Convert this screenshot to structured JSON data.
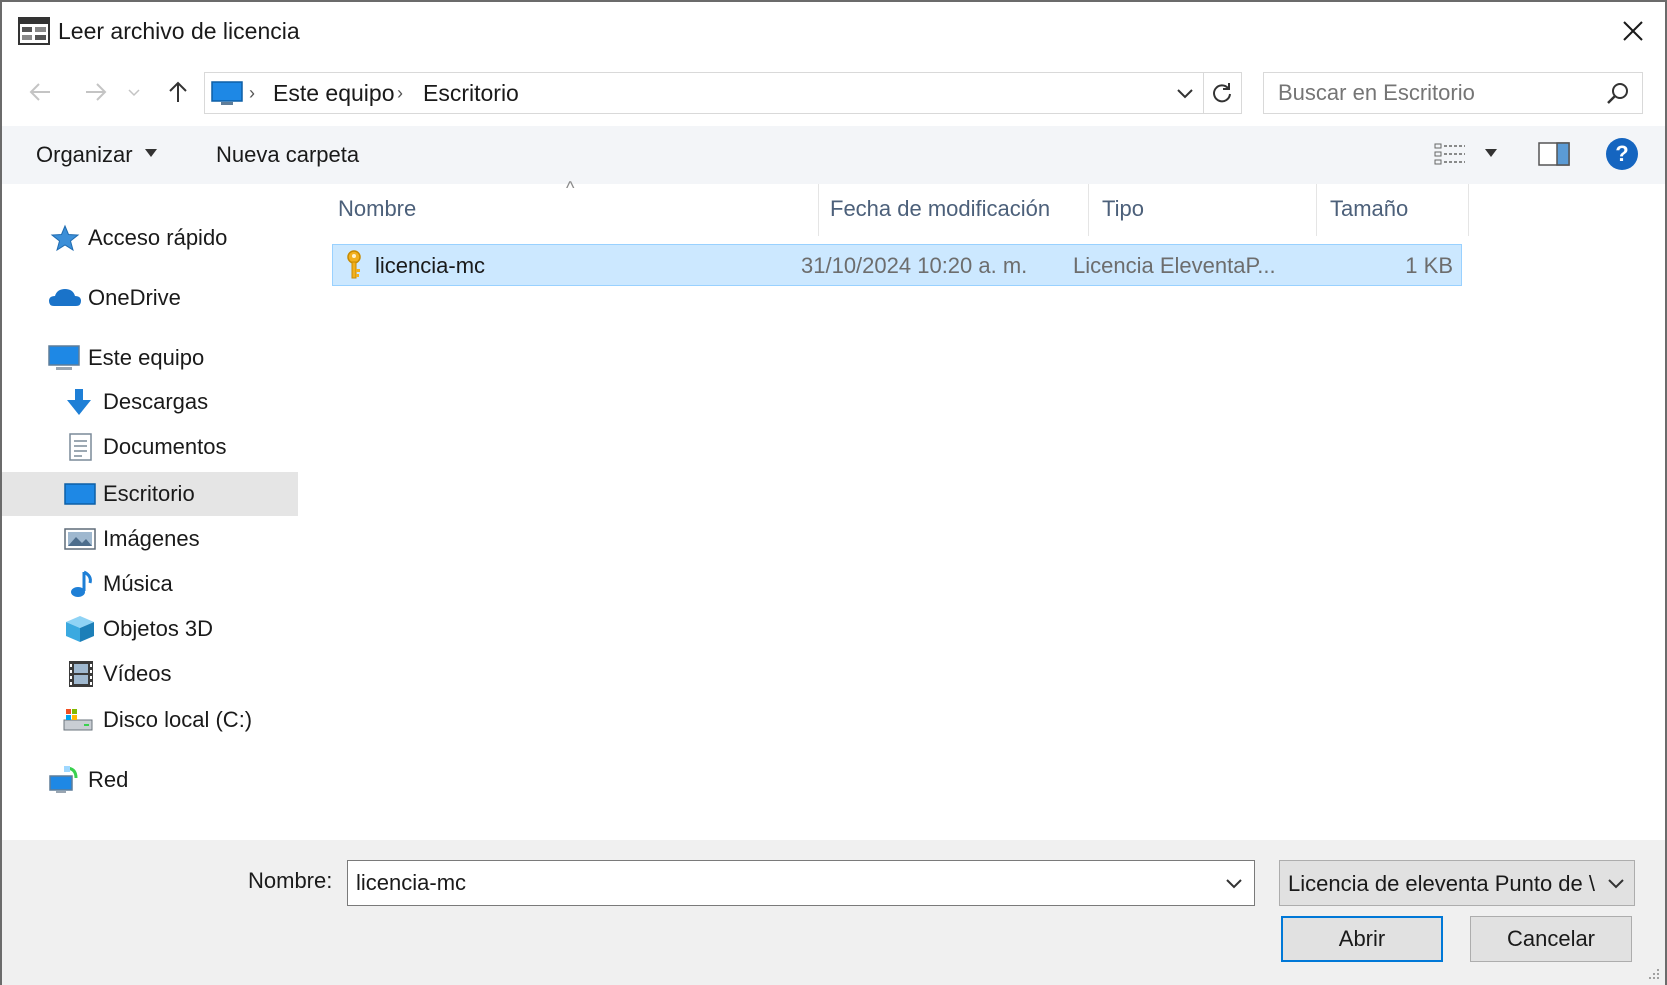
{
  "window": {
    "title": "Leer archivo de licencia",
    "close_glyph": "✕"
  },
  "navbar": {
    "back_glyph": "←",
    "forward_glyph": "→",
    "recent_glyph": "⌄",
    "up_glyph": "↑",
    "breadcrumb": [
      "Este equipo",
      "Escritorio"
    ],
    "breadcrumb_sep": "›",
    "refresh_glyph": "↻",
    "search_placeholder": "Buscar en Escritorio"
  },
  "toolbar": {
    "organize_label": "Organizar",
    "new_folder_label": "Nueva carpeta",
    "help_glyph": "?"
  },
  "sidebar": {
    "items": [
      {
        "label": "Acceso rápido",
        "icon": "star-icon"
      },
      {
        "label": "OneDrive",
        "icon": "cloud-icon"
      },
      {
        "label": "Este equipo",
        "icon": "computer-icon"
      },
      {
        "label": "Descargas",
        "icon": "download-icon"
      },
      {
        "label": "Documentos",
        "icon": "document-icon"
      },
      {
        "label": "Escritorio",
        "icon": "desktop-icon",
        "selected": true
      },
      {
        "label": "Imágenes",
        "icon": "pictures-icon"
      },
      {
        "label": "Música",
        "icon": "music-icon"
      },
      {
        "label": "Objetos 3D",
        "icon": "cube-icon"
      },
      {
        "label": "Vídeos",
        "icon": "video-icon"
      },
      {
        "label": "Disco local (C:)",
        "icon": "drive-icon"
      },
      {
        "label": "Red",
        "icon": "network-icon"
      }
    ]
  },
  "filelist": {
    "sort_glyph": "^",
    "columns": [
      "Nombre",
      "Fecha de modificación",
      "Tipo",
      "Tamaño"
    ],
    "rows": [
      {
        "name": "licencia-mc",
        "modified": "31/10/2024 10:20 a. m.",
        "type": "Licencia EleventaP...",
        "size": "1 KB",
        "icon": "key-icon",
        "selected": true
      }
    ]
  },
  "bottom": {
    "name_label": "Nombre:",
    "name_value": "licencia-mc",
    "filetype_value": "Licencia de eleventa Punto de \\",
    "open_label": "Abrir",
    "cancel_label": "Cancelar"
  },
  "colors": {
    "selection_bg": "#cce8ff",
    "selection_border": "#99d1ff",
    "accent": "#0078d7",
    "header_text": "#4c607a"
  }
}
